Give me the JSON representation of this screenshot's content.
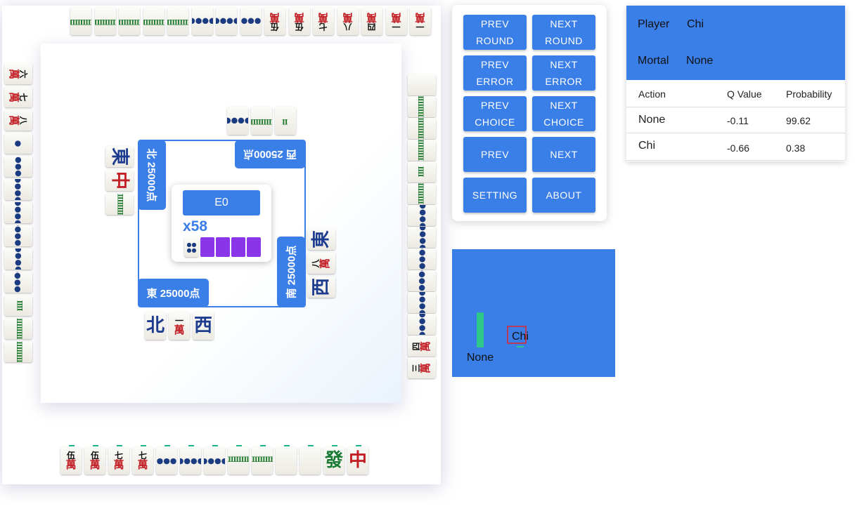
{
  "tiles": {
    "top_river": [
      "8-sou",
      "8-sou",
      "8-sou",
      "8-sou",
      "8-sou",
      "8-pin",
      "4-pin",
      "5-pin",
      "5-man",
      "5-man",
      "7-man",
      "8-man",
      "4-man",
      "1-man",
      "1-man"
    ],
    "left_river": [
      "6-man",
      "7-man",
      "8-man",
      "1-pin",
      "3-pin",
      "6-pin",
      "6-pin",
      "5-pin",
      "8-pin",
      "7-pin",
      "2-sou",
      "4-sou",
      "4-sou"
    ],
    "right_river": [
      "white",
      "9-sou",
      "9-sou",
      "9-sou",
      "2-sou",
      "6-sou",
      "8-pin",
      "8-pin",
      "9-pin",
      "7-pin",
      "6-pin",
      "6-pin",
      "4-man",
      "3-man"
    ],
    "bottom_hand": [
      "5-man",
      "5-man",
      "7-man",
      "7-man",
      "3-pin",
      "6-pin",
      "8-pin",
      "7-sou",
      "8-sou",
      "white",
      "white",
      "green",
      "red"
    ],
    "north_meld": [
      "4-pin",
      "8-sou",
      "1-sou"
    ],
    "west_meld": [
      "east",
      "red",
      "8-sou"
    ],
    "east_meld": [
      "east",
      "8-man",
      "west"
    ],
    "south_meld": [
      "north",
      "1-man",
      "west"
    ]
  },
  "glyphs": {
    "red": "中",
    "green": "發",
    "east": "東",
    "west": "西",
    "north": "北",
    "man": "萬",
    "num": {
      "1": "一",
      "3": "三",
      "4": "四",
      "5": "伍",
      "6": "六",
      "7": "七",
      "8": "八"
    }
  },
  "seats": {
    "east": "東 25000点",
    "south": "南 25000点",
    "west": "西 25000点",
    "north": "北 25000点"
  },
  "center": {
    "round": "E0",
    "honba": "x58",
    "riichi_sticks": 4
  },
  "controls": {
    "prev_round": "PREV ROUND",
    "next_round": "NEXT ROUND",
    "prev_error": "PREV ERROR",
    "next_error": "NEXT ERROR",
    "prev_choice": "PREV CHOICE",
    "next_choice": "NEXT CHOICE",
    "prev": "PREV",
    "next": "NEXT",
    "setting": "SETTING",
    "about": "ABOUT"
  },
  "info": {
    "player_label": "Player",
    "player_value": "Chi",
    "mortal_label": "Mortal",
    "mortal_value": "None",
    "col_action": "Action",
    "col_q": "Q Value",
    "col_prob": "Probability",
    "rows": [
      {
        "action": "None",
        "q": "-0.11",
        "prob": "99.62"
      },
      {
        "action": "Chi",
        "q": "-0.66",
        "prob": "0.38"
      }
    ]
  },
  "chart_data": {
    "type": "bar",
    "categories": [
      "None",
      "Chi"
    ],
    "values": [
      99.62,
      0.38
    ],
    "highlighted": "Chi",
    "bar_color": "#2ec98a",
    "bg_color": "#3a7ee8"
  }
}
